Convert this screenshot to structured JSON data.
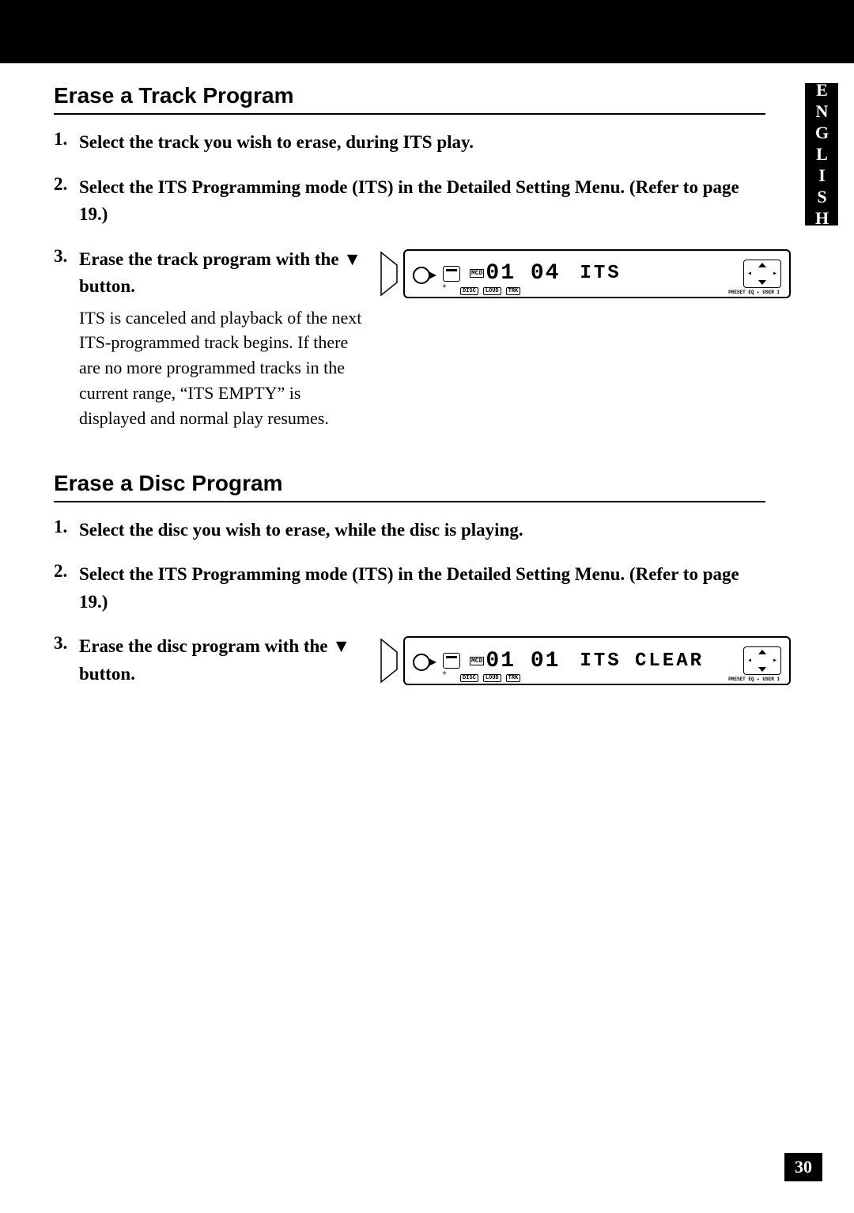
{
  "language_tab": "ENGLISH",
  "page_number": "30",
  "section1": {
    "heading": "Erase a Track Program",
    "steps": [
      {
        "title": "Select the track you wish to erase, during ITS play."
      },
      {
        "title": "Select the ITS Programming mode (ITS) in the Detailed Setting Menu. (Refer to page 19.)"
      },
      {
        "title": "Erase the track program with the ▼ button.",
        "body": "ITS is canceled and playback of the next ITS-programmed track begins. If there are no more programmed tracks in the current range, “ITS EMPTY” is displayed and normal play resumes."
      }
    ],
    "display": {
      "nums": "01 04",
      "text": "ITS",
      "preset": "PRESET EQ ▸  USER 1"
    }
  },
  "section2": {
    "heading": "Erase a Disc Program",
    "steps": [
      {
        "title": "Select the disc you wish to erase, while the disc is playing."
      },
      {
        "title": "Select the ITS Programming mode (ITS) in the Detailed Setting Menu. (Refer to page 19.)"
      },
      {
        "title": "Erase the disc program with the ▼ button."
      }
    ],
    "display": {
      "nums": "01 01",
      "text": "ITS CLEAR",
      "preset": "PRESET EQ ▸  USER 1"
    }
  },
  "sublabels": [
    "DISC",
    "LOUD",
    "TRK"
  ]
}
